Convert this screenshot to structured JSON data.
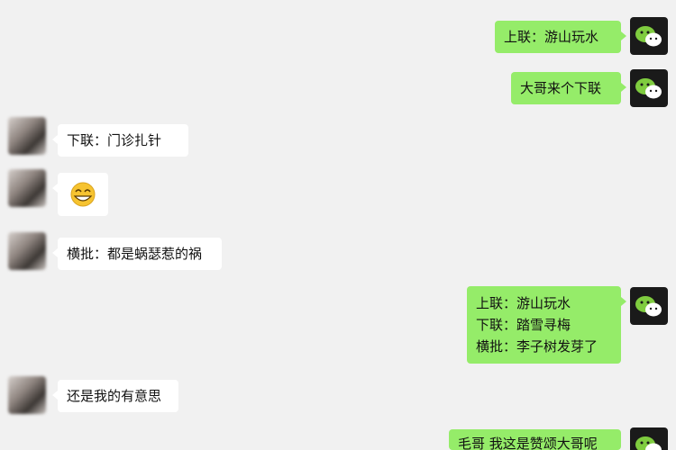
{
  "messages": [
    {
      "id": "m1",
      "side": "right",
      "lines": [
        "上联：游山玩水"
      ]
    },
    {
      "id": "m2",
      "side": "right",
      "lines": [
        "大哥来个下联"
      ]
    },
    {
      "id": "m3",
      "side": "left",
      "lines": [
        "下联：门诊扎针"
      ]
    },
    {
      "id": "m4",
      "side": "left",
      "sticker": "grinning-face-emoji"
    },
    {
      "id": "m5",
      "side": "left",
      "lines": [
        "横批：都是蜗瑟惹的祸"
      ]
    },
    {
      "id": "m6",
      "side": "right",
      "lines": [
        "上联：游山玩水",
        "下联：踏雪寻梅",
        "横批：李子树发芽了"
      ]
    },
    {
      "id": "m7",
      "side": "left",
      "lines": [
        "还是我的有意思"
      ]
    },
    {
      "id": "m8",
      "side": "right",
      "lines": [
        "毛哥 我这是赞颂大哥呢"
      ]
    }
  ],
  "avatars": {
    "self": "wechat-logo-icon",
    "other": "blurred-person-avatar"
  },
  "colors": {
    "background": "#f1f1f1",
    "outgoing_bubble": "#95ec69",
    "incoming_bubble": "#ffffff"
  }
}
